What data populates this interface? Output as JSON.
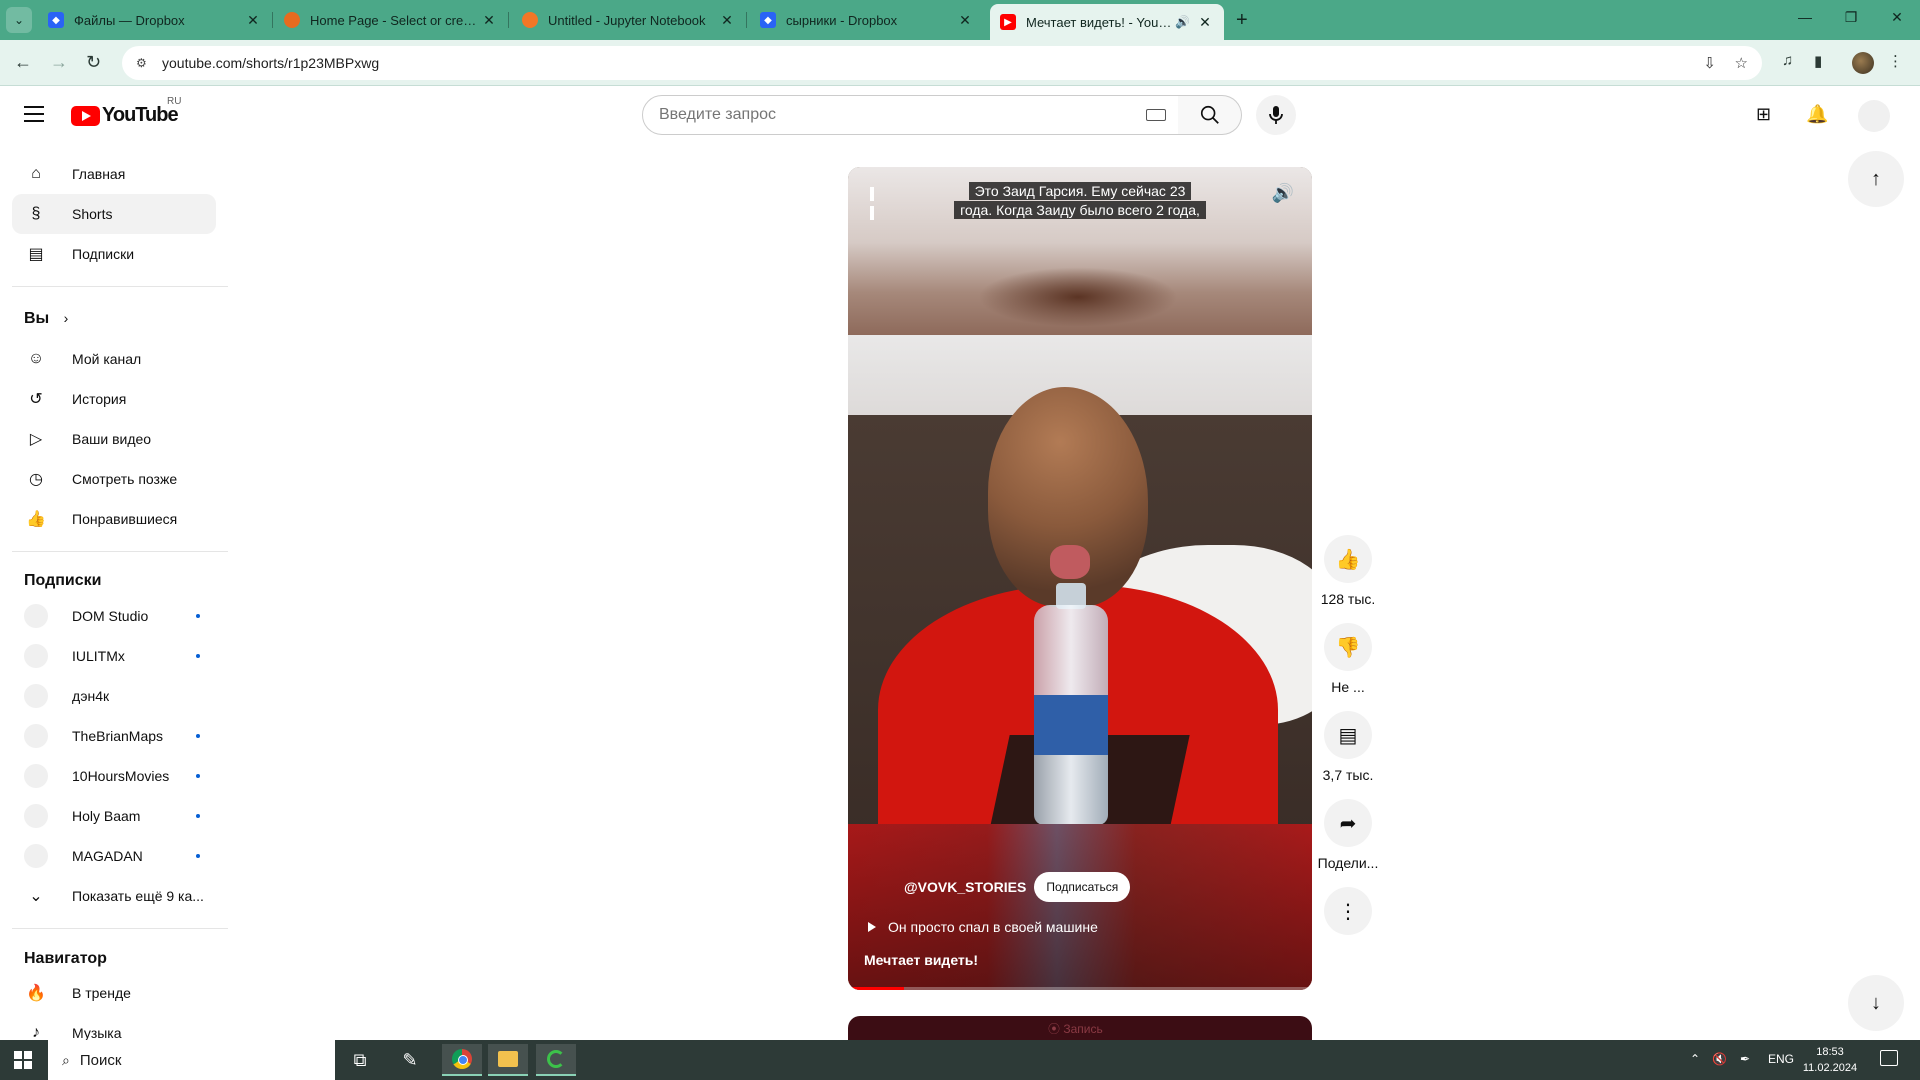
{
  "browser": {
    "tabs": [
      {
        "title": "Файлы — Dropbox",
        "favicon": "dropbox-icon"
      },
      {
        "title": "Home Page - Select or create a",
        "favicon": "anaconda-icon"
      },
      {
        "title": "Untitled - Jupyter Notebook",
        "favicon": "jupyter-icon"
      },
      {
        "title": "сырники - Dropbox",
        "favicon": "dropbox-icon"
      },
      {
        "title": "Мечтает видеть! - YouTube",
        "favicon": "youtube-icon",
        "active": true
      }
    ],
    "url": "youtube.com/shorts/r1p23MBPxwg",
    "accent_color": "#4ba888"
  },
  "masthead": {
    "region": "RU",
    "search_placeholder": "Введите запрос"
  },
  "sidebar": {
    "main": [
      {
        "label": "Главная",
        "icon": "home-icon"
      },
      {
        "label": "Shorts",
        "icon": "shorts-icon",
        "active": true
      },
      {
        "label": "Подписки",
        "icon": "subscriptions-icon"
      }
    ],
    "you_heading": "Вы",
    "you_items": [
      {
        "label": "Мой канал",
        "icon": "my-channel-icon"
      },
      {
        "label": "История",
        "icon": "history-icon"
      },
      {
        "label": "Ваши видео",
        "icon": "your-videos-icon"
      },
      {
        "label": "Смотреть позже",
        "icon": "watch-later-icon"
      },
      {
        "label": "Понравившиеся",
        "icon": "liked-icon"
      }
    ],
    "subs_heading": "Подписки",
    "subscriptions": [
      {
        "name": "DOM Studio",
        "new": true
      },
      {
        "name": "IULITMx",
        "new": true
      },
      {
        "name": "дэн4к",
        "new": false
      },
      {
        "name": "TheBrianMaps",
        "new": true
      },
      {
        "name": "10HoursMovies",
        "new": true
      },
      {
        "name": "Holy Baam",
        "new": true
      },
      {
        "name": "MAGADAN",
        "new": true
      }
    ],
    "show_more": "Показать ещё 9 ка...",
    "navigator_heading": "Навигатор",
    "navigator_items": [
      {
        "label": "В тренде",
        "icon": "trending-icon"
      },
      {
        "label": "Музыка",
        "icon": "music-icon"
      }
    ]
  },
  "short": {
    "caption_line1": "Это Заид Гарсия. Ему сейчас 23",
    "caption_line2": "года. Когда Заиду было всего 2 года,",
    "channel": "@VOVK_STORIES",
    "subscribe_label": "Подписаться",
    "chip": "Он просто спал в своей машине",
    "title": "Мечтает видеть!",
    "progress_percent": 12,
    "next_card_text": "⦿ Запись"
  },
  "actions": {
    "likes": "128 тыс.",
    "dislike": "Не ...",
    "comments": "3,7 тыс.",
    "share": "Подели..."
  },
  "taskbar": {
    "search_placeholder": "Поиск",
    "lang": "ENG",
    "time": "18:53",
    "date": "11.02.2024"
  }
}
